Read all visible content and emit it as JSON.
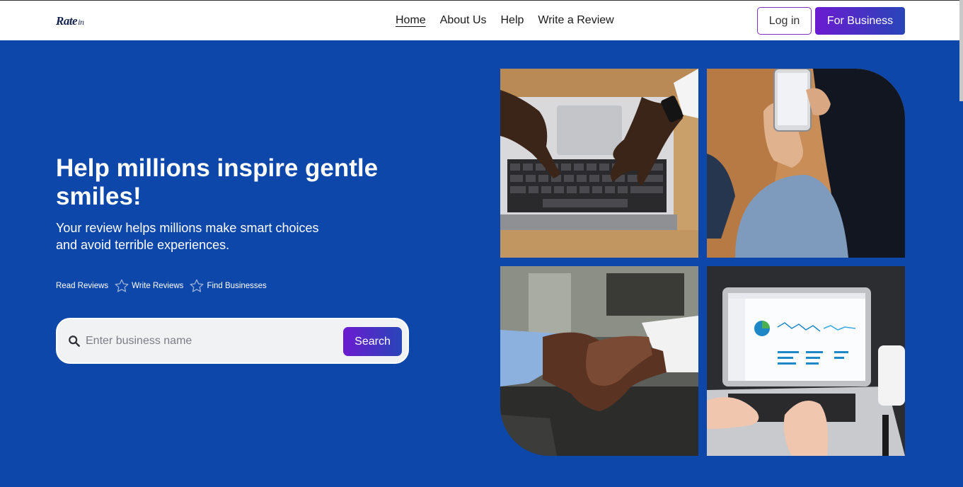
{
  "brand": {
    "logo_main": "Rate",
    "logo_suffix": "in"
  },
  "nav": {
    "items": [
      {
        "label": "Home",
        "active": true
      },
      {
        "label": "About Us",
        "active": false
      },
      {
        "label": "Help",
        "active": false
      },
      {
        "label": "Write a Review",
        "active": false
      }
    ],
    "login_label": "Log in",
    "business_label": "For Business"
  },
  "hero": {
    "title": "Help millions inspire gentle smiles!",
    "subtitle": "Your review helps millions make smart choices and avoid terrible experiences.",
    "features": [
      "Read Reviews",
      "Write Reviews",
      "Find Businesses"
    ],
    "feature_separator_icon": "star-outline-icon"
  },
  "search": {
    "placeholder": "Enter business name",
    "value": "",
    "button_label": "Search",
    "icon": "search-icon"
  },
  "gallery": {
    "images": [
      {
        "subject": "hands-typing-laptop-image"
      },
      {
        "subject": "person-holding-phone-image"
      },
      {
        "subject": "handshake-image"
      },
      {
        "subject": "laptop-analytics-dashboard-image"
      }
    ]
  },
  "colors": {
    "hero_background": "#0d47a9",
    "accent_gradient_start": "#6b1bd0",
    "accent_gradient_end": "#2945b8",
    "login_border": "#7b2fc2"
  }
}
